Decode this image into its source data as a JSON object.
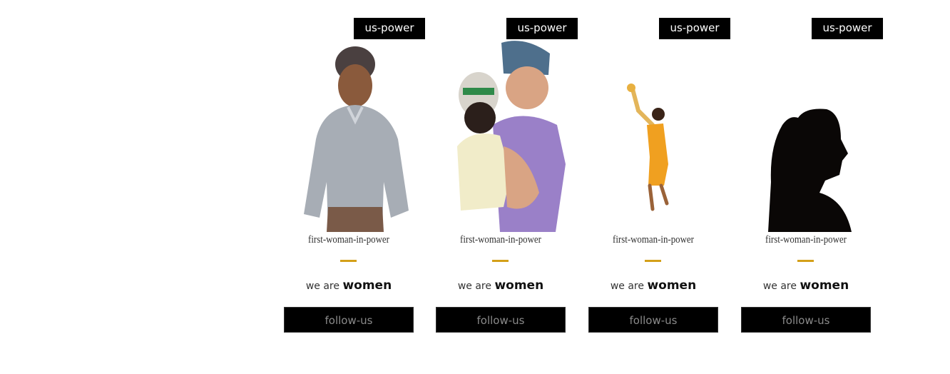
{
  "cards": [
    {
      "badge": "us-power",
      "name": "first-woman-in-power",
      "tag_prefix": "we are",
      "tag_bold": "women",
      "button": "follow-us"
    },
    {
      "badge": "us-power",
      "name": "first-woman-in-power",
      "tag_prefix": "we are",
      "tag_bold": "women",
      "button": "follow-us"
    },
    {
      "badge": "us-power",
      "name": "first-woman-in-power",
      "tag_prefix": "we are",
      "tag_bold": "women",
      "button": "follow-us"
    },
    {
      "badge": "us-power",
      "name": "first-woman-in-power",
      "tag_prefix": "we are",
      "tag_bold": "women",
      "button": "follow-us"
    }
  ],
  "colors": {
    "badge_bg": "#000000",
    "accent_dash": "#d4a019",
    "button_bg": "#000000",
    "button_text": "#8a8a8a"
  }
}
